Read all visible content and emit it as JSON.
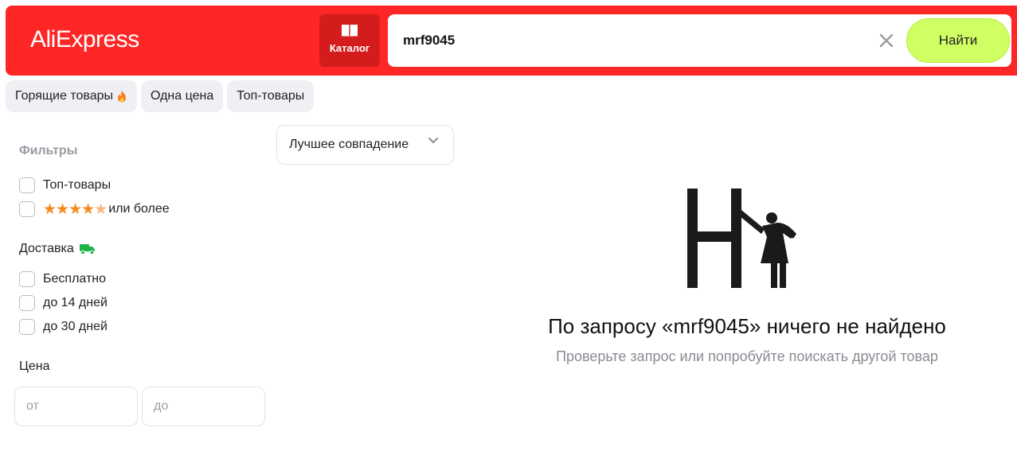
{
  "header": {
    "logo": "AliExpress",
    "catalog_label": "Каталог",
    "search_value": "mrf9045",
    "find_label": "Найти",
    "brand_color": "#ff2626",
    "find_color": "#cfff63"
  },
  "chips": [
    {
      "label": "Горящие товары",
      "icon": "flame-icon"
    },
    {
      "label": "Одна цена"
    },
    {
      "label": "Топ-товары"
    }
  ],
  "sort": {
    "selected": "Лучшее совпадение"
  },
  "filters": {
    "title": "Фильтры",
    "top_products": "Топ-товары",
    "rating": {
      "stars": 4.5,
      "label": "или более"
    },
    "delivery": {
      "title": "Доставка",
      "icon": "truck-icon",
      "options": [
        "Бесплатно",
        "до 14 дней",
        "до 30 дней"
      ]
    },
    "price": {
      "title": "Цена",
      "from_placeholder": "от",
      "to_placeholder": "до"
    }
  },
  "empty_state": {
    "title": "По запросу «mrf9045» ничего не найдено",
    "subtitle": "Проверьте запрос или попробуйте поискать другой товар"
  }
}
